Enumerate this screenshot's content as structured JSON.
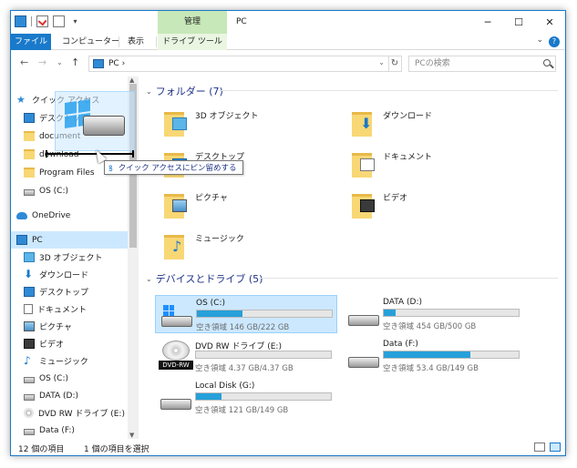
{
  "window": {
    "title": "PC",
    "manage_tab": "管理",
    "min": "─",
    "max": "☐",
    "close": "✕"
  },
  "ribbon": {
    "tabs": [
      "ファイル",
      "コンピューター",
      "表示",
      "ドライブ ツール"
    ],
    "expand": "⌄",
    "help": "?"
  },
  "nav": {
    "back": "←",
    "forward": "→",
    "recent": "⌄",
    "up": "↑",
    "address": "PC  ›",
    "dropdown": "⌄",
    "refresh": "↻",
    "search_placeholder": "PCの検索"
  },
  "sidebar": {
    "items": [
      {
        "label": "クイック アクセス",
        "icon": "star-icon"
      },
      {
        "label": "デスクトップ",
        "icon": "desktop-icon"
      },
      {
        "label": "document",
        "icon": "folder-icon"
      },
      {
        "label": "download",
        "icon": "folder-icon"
      },
      {
        "label": "Program Files",
        "icon": "folder-icon"
      },
      {
        "label": "OS (C:)",
        "icon": "drive-icon"
      },
      {
        "label": "OneDrive",
        "icon": "cloud-icon"
      },
      {
        "label": "PC",
        "icon": "pc-icon"
      },
      {
        "label": "3D オブジェクト",
        "icon": "cube-icon"
      },
      {
        "label": "ダウンロード",
        "icon": "download-icon"
      },
      {
        "label": "デスクトップ",
        "icon": "desktop-icon"
      },
      {
        "label": "ドキュメント",
        "icon": "document-icon"
      },
      {
        "label": "ピクチャ",
        "icon": "picture-icon"
      },
      {
        "label": "ビデオ",
        "icon": "video-icon"
      },
      {
        "label": "ミュージック",
        "icon": "music-icon"
      },
      {
        "label": "OS (C:)",
        "icon": "drive-icon"
      },
      {
        "label": "DATA (D:)",
        "icon": "drive-icon"
      },
      {
        "label": "DVD RW ドライブ (E:)",
        "icon": "dvd-icon"
      },
      {
        "label": "Data (F:)",
        "icon": "drive-icon"
      }
    ]
  },
  "content": {
    "folders_header": "フォルダー (7)",
    "folders": [
      {
        "label": "3D オブジェクト"
      },
      {
        "label": "ダウンロード"
      },
      {
        "label": "デスクトップ"
      },
      {
        "label": "ドキュメント"
      },
      {
        "label": "ピクチャ"
      },
      {
        "label": "ビデオ"
      },
      {
        "label": "ミュージック"
      }
    ],
    "drives_header": "デバイスとドライブ (5)",
    "drives": [
      {
        "name": "OS (C:)",
        "free": "空き領域 146 GB/222 GB",
        "used_fraction": 0.34
      },
      {
        "name": "DATA (D:)",
        "free": "空き領域 454 GB/500 GB",
        "used_fraction": 0.09
      },
      {
        "name": "DVD RW ドライブ (E:)",
        "free": "空き領域 4.37 GB/4.37 GB",
        "used_fraction": 0.0,
        "badge": "DVD-RW"
      },
      {
        "name": "Data (F:)",
        "free": "空き領域 53.4 GB/149 GB",
        "used_fraction": 0.64
      },
      {
        "name": "Local Disk (G:)",
        "free": "空き領域 121 GB/149 GB",
        "used_fraction": 0.19
      }
    ]
  },
  "status": {
    "item_count": "12 個の項目",
    "selected": "1 個の項目を選択"
  },
  "drag": {
    "tooltip": "クイック アクセスにピン留めする"
  },
  "colors": {
    "accent": "#1979ca",
    "selection": "#cce8ff",
    "manage_tab": "#c7e8b8",
    "bar_fill": "#26a0da"
  }
}
